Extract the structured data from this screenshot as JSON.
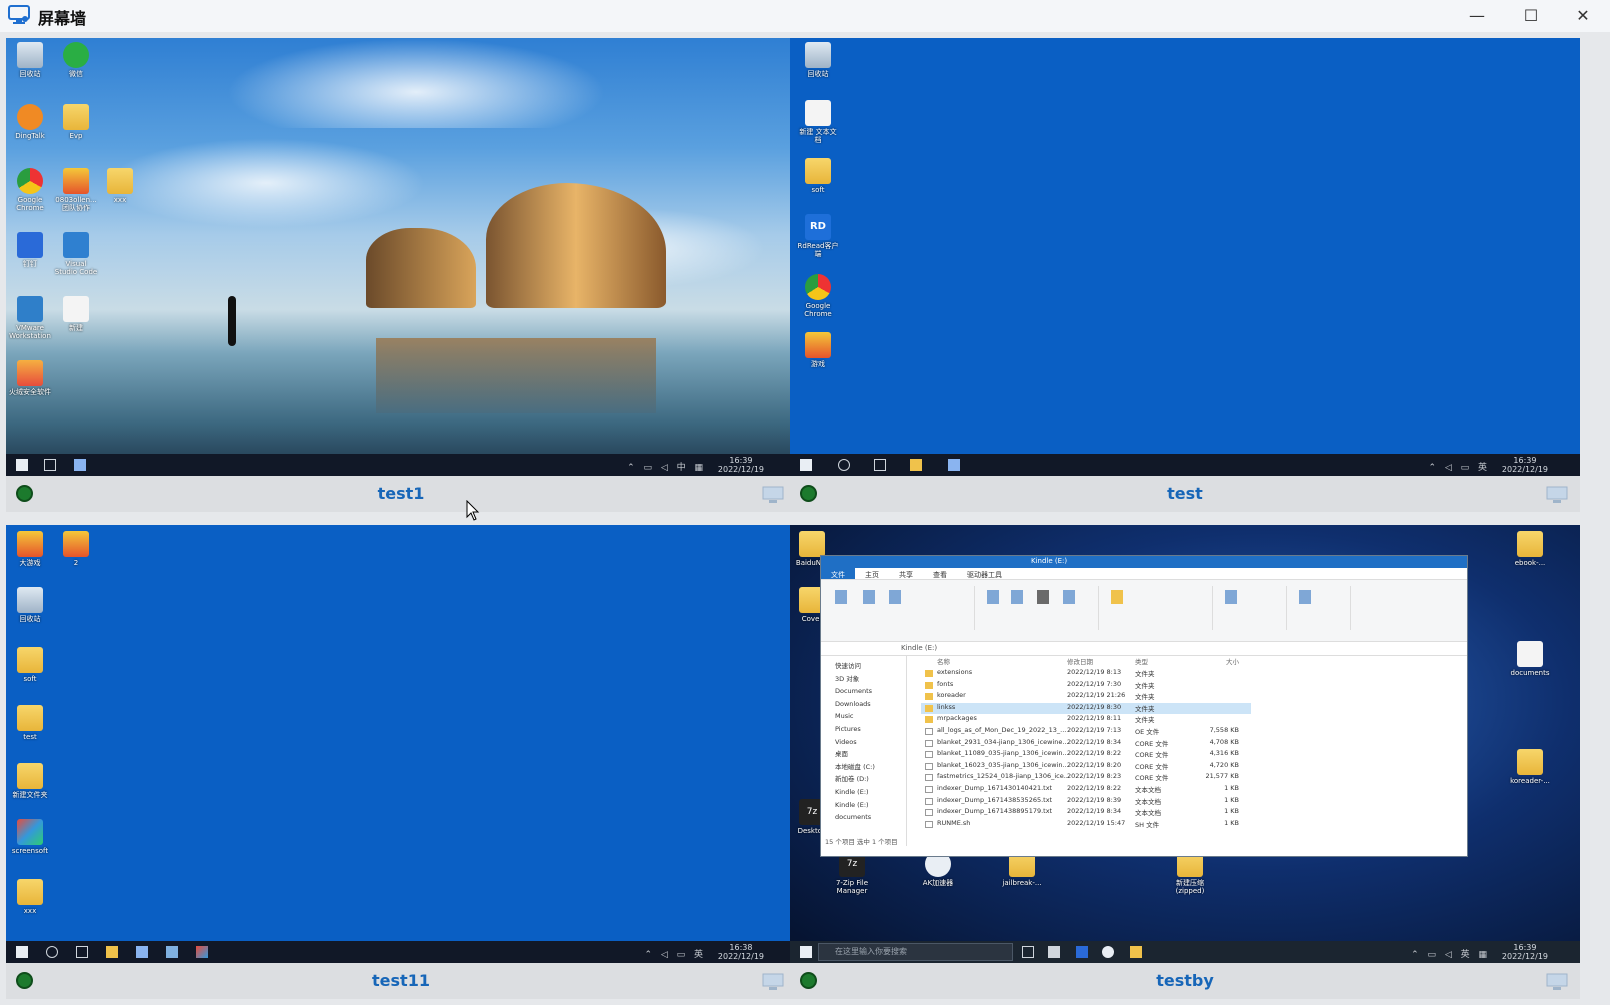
{
  "window": {
    "title": "屏幕墙",
    "minimize_glyph": "—",
    "maximize_glyph": "☐",
    "close_glyph": "✕",
    "icon": "monitor-icon"
  },
  "colors": {
    "accent": "#1766b8",
    "online": "#1c7a2d",
    "desktop_blue": "#0a5fc4"
  },
  "panels": [
    {
      "name": "test1",
      "status": "online",
      "clock_time": "16:39",
      "clock_date": "2022/12/19",
      "desktop_icons": [
        {
          "label": "回收站"
        },
        {
          "label": "微信"
        },
        {
          "label": "DingTalk"
        },
        {
          "label": "Evp"
        },
        {
          "label": "Google Chrome"
        },
        {
          "label": "0803ollen... 团队协作"
        },
        {
          "label": "xxx"
        },
        {
          "label": "钉钉"
        },
        {
          "label": "Visual Studio Code"
        },
        {
          "label": "VMware Workstation"
        },
        {
          "label": "新建"
        },
        {
          "label": "火绒安全软件"
        }
      ]
    },
    {
      "name": "test",
      "status": "online",
      "clock_time": "16:39",
      "clock_date": "2022/12/19",
      "desktop_icons": [
        {
          "label": "回收站"
        },
        {
          "label": "新建 文本文档"
        },
        {
          "label": "soft"
        },
        {
          "label": "RdRead客户端"
        },
        {
          "label": "Google Chrome"
        },
        {
          "label": "游戏"
        }
      ]
    },
    {
      "name": "test11",
      "status": "online",
      "clock_time": "16:38",
      "clock_date": "2022/12/19",
      "desktop_icons": [
        {
          "label": "大游戏"
        },
        {
          "label": "2"
        },
        {
          "label": "回收站"
        },
        {
          "label": "soft"
        },
        {
          "label": "test"
        },
        {
          "label": "新建文件夹"
        },
        {
          "label": "screensoft"
        },
        {
          "label": "xxx"
        }
      ]
    },
    {
      "name": "testby",
      "status": "online",
      "clock_time": "16:39",
      "clock_date": "2022/12/19",
      "search_placeholder": "在这里输入你要搜索",
      "desktop_icons": [
        {
          "label": "BaiduNet"
        },
        {
          "label": "Cover"
        },
        {
          "label": "7-Zip File Manager"
        },
        {
          "label": "AK加速器"
        },
        {
          "label": "jailbreak-..."
        },
        {
          "label": "新建压缩(zipped)"
        },
        {
          "label": "ebook-..."
        },
        {
          "label": "koreader-..."
        },
        {
          "label": "documents"
        },
        {
          "label": "Desktop"
        }
      ],
      "explorer": {
        "title": "Kindle (E:)",
        "tabs": [
          "文件",
          "主页",
          "共享",
          "查看",
          "驱动器工具"
        ],
        "address": "Kindle (E:)",
        "nav": [
          "快速访问",
          "3D 对象",
          "Documents",
          "Downloads",
          "Music",
          "Pictures",
          "Videos",
          "桌面",
          "本地磁盘 (C:)",
          "新加卷 (D:)",
          "Kindle (E:)",
          "Kindle (E:)",
          "documents"
        ],
        "columns": [
          "名称",
          "修改日期",
          "类型",
          "大小"
        ],
        "rows": [
          {
            "name": "extensions",
            "date": "2022/12/19 8:13",
            "type": "文件夹",
            "size": ""
          },
          {
            "name": "fonts",
            "date": "2022/12/19 7:30",
            "type": "文件夹",
            "size": ""
          },
          {
            "name": "koreader",
            "date": "2022/12/19 21:26",
            "type": "文件夹",
            "size": ""
          },
          {
            "name": "linkss",
            "date": "2022/12/19 8:30",
            "type": "文件夹",
            "size": ""
          },
          {
            "name": "mrpackages",
            "date": "2022/12/19 8:11",
            "type": "文件夹",
            "size": ""
          },
          {
            "name": "all_logs_as_of_Mon_Dec_19_2022_13_...",
            "date": "2022/12/19 7:13",
            "type": "OE 文件",
            "size": "7,558 KB"
          },
          {
            "name": "blanket_2931_034-jianp_1306_icewine...",
            "date": "2022/12/19 8:34",
            "type": "CORE 文件",
            "size": "4,708 KB"
          },
          {
            "name": "blanket_11089_035-jianp_1306_icewin...",
            "date": "2022/12/19 8:22",
            "type": "CORE 文件",
            "size": "4,316 KB"
          },
          {
            "name": "blanket_16023_035-jianp_1306_icewin...",
            "date": "2022/12/19 8:20",
            "type": "CORE 文件",
            "size": "4,720 KB"
          },
          {
            "name": "fastmetrics_12524_018-jianp_1306_ice...",
            "date": "2022/12/19 8:23",
            "type": "CORE 文件",
            "size": "21,577 KB"
          },
          {
            "name": "indexer_Dump_1671430140421.txt",
            "date": "2022/12/19 8:22",
            "type": "文本文档",
            "size": "1 KB"
          },
          {
            "name": "indexer_Dump_1671438535265.txt",
            "date": "2022/12/19 8:39",
            "type": "文本文档",
            "size": "1 KB"
          },
          {
            "name": "indexer_Dump_1671438895179.txt",
            "date": "2022/12/19 8:34",
            "type": "文本文档",
            "size": "1 KB"
          },
          {
            "name": "RUNME.sh",
            "date": "2022/12/19 15:47",
            "type": "SH 文件",
            "size": "1 KB"
          }
        ],
        "selected_index": 3,
        "status": "15 个项目   选中 1 个项目"
      }
    }
  ]
}
